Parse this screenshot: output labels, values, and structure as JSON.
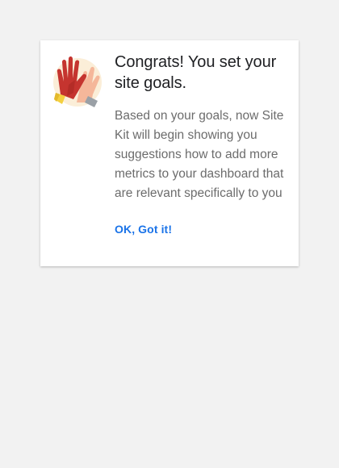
{
  "dialog": {
    "illustration": "high-five-icon",
    "title": "Congrats! You set your site goals.",
    "body": "Based on your goals, now Site Kit will begin showing you suggestions how to add more metrics to your dashboard that are relevant specifically to you",
    "button_label": "OK, Got it!"
  },
  "colors": {
    "background": "#f2f2f2",
    "card": "#ffffff",
    "accent": "#1a73e8",
    "title_text": "#202124",
    "body_text": "#6c6c6c"
  }
}
